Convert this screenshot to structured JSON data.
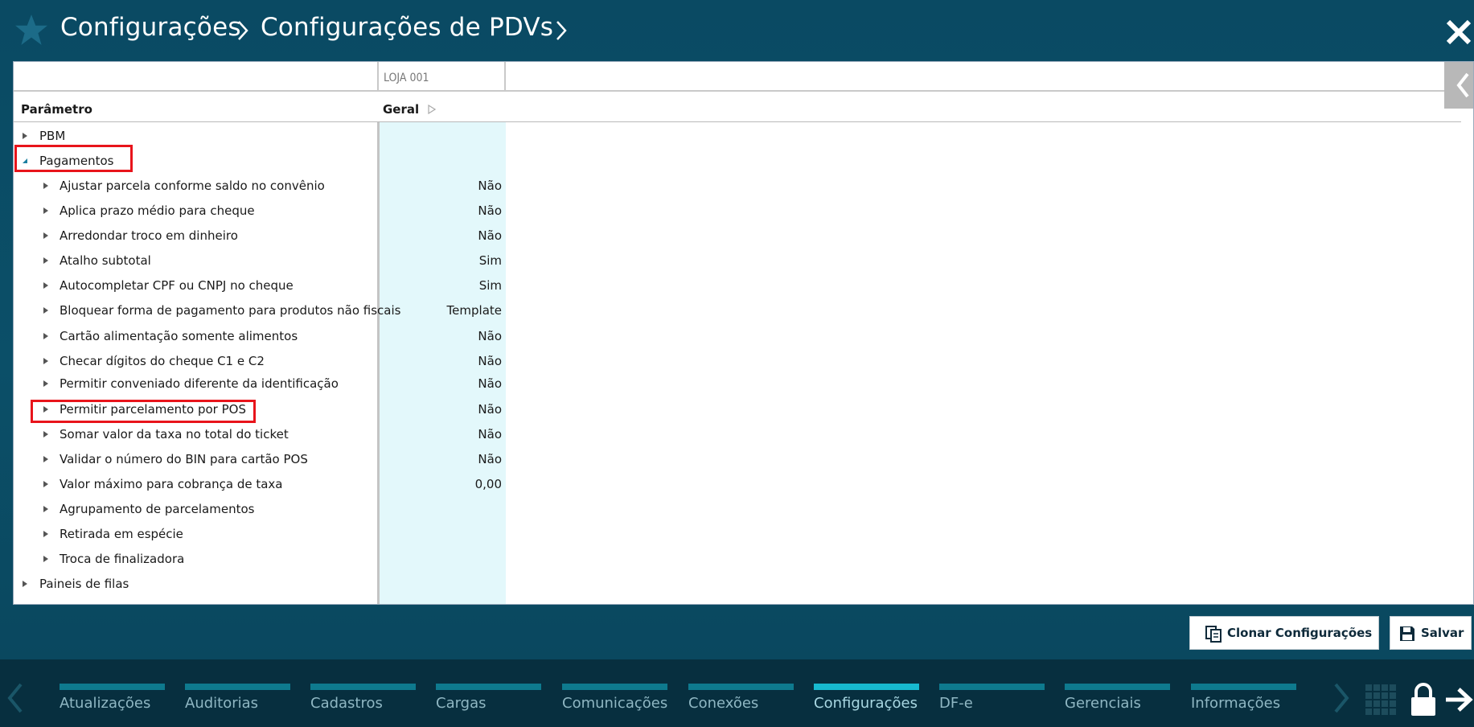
{
  "header": {
    "breadcrumb_1": "Configurações",
    "breadcrumb_2": "Configurações de PDVs"
  },
  "grid": {
    "store": "LOJA 001",
    "col_param": "Parâmetro",
    "col_geral": "Geral",
    "groups": [
      {
        "label": "PBM",
        "expanded": false
      },
      {
        "label": "Pagamentos",
        "expanded": true
      },
      {
        "label": "Paineis de filas",
        "expanded": false
      }
    ],
    "rows": [
      {
        "label": "Ajustar parcela conforme saldo no convênio",
        "value": "Não"
      },
      {
        "label": "Aplica prazo médio para cheque",
        "value": "Não"
      },
      {
        "label": "Arredondar troco em dinheiro",
        "value": "Não"
      },
      {
        "label": "Atalho subtotal",
        "value": "Sim"
      },
      {
        "label": "Autocompletar CPF ou CNPJ no cheque",
        "value": "Sim"
      },
      {
        "label": "Bloquear forma de pagamento para produtos não fiscais",
        "value": "Template"
      },
      {
        "label": "Cartão alimentação somente alimentos",
        "value": "Não"
      },
      {
        "label": "Checar dígitos do cheque C1 e C2",
        "value": "Não"
      },
      {
        "label": "Permitir conveniado diferente da identificação",
        "value": "Não"
      },
      {
        "label": "Permitir parcelamento por POS",
        "value": "Não"
      },
      {
        "label": "Somar valor da taxa no total do ticket",
        "value": "Não"
      },
      {
        "label": "Validar o número do BIN para cartão POS",
        "value": "Não"
      },
      {
        "label": "Valor máximo para cobrança de taxa",
        "value": "0,00"
      },
      {
        "label": "Agrupamento de parcelamentos",
        "value": ""
      },
      {
        "label": "Retirada em espécie",
        "value": ""
      },
      {
        "label": "Troca de finalizadora",
        "value": ""
      }
    ]
  },
  "buttons": {
    "clone": "Clonar Configurações",
    "save": "Salvar"
  },
  "nav": {
    "items": [
      "Atualizações",
      "Auditorias",
      "Cadastros",
      "Cargas",
      "Comunicações",
      "Conexões",
      "Configurações",
      "DF-e",
      "Gerenciais",
      "Informações"
    ],
    "active": "Configurações"
  },
  "colors": {
    "header_bg": "#0a4a63",
    "nav_bg": "#072f3f",
    "highlight": "#e8141b",
    "value_col_bg": "#e3f8fb",
    "nav_active": "#17b9cf"
  }
}
